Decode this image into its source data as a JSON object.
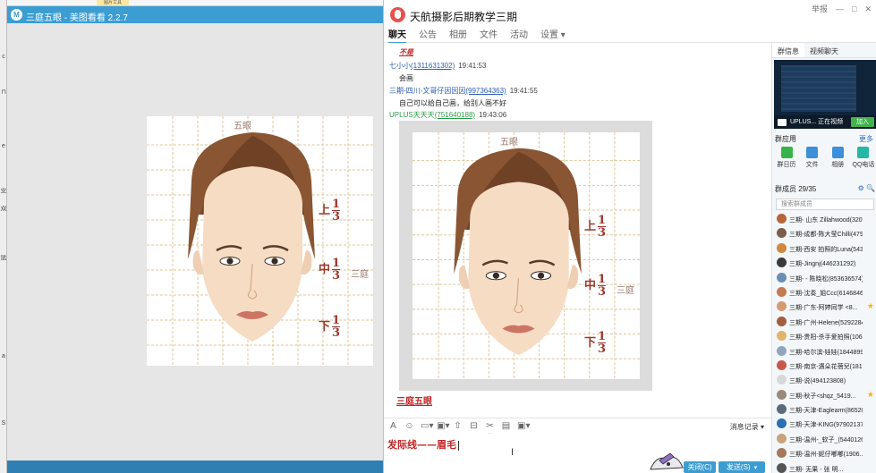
{
  "viewer": {
    "window_title": "三庭五眼 - 美图看看 2.2.7",
    "top_tab": "图片工具",
    "image": {
      "title": "五眼",
      "upper_label": "上",
      "middle_label": "中",
      "lower_label": "下",
      "numerator": "1",
      "denominator": "3",
      "side_label": "三庭"
    }
  },
  "chat": {
    "group_name": "天航摄影后期教学三期",
    "window_buttons": {
      "report": "举报",
      "minimize": "—",
      "maximize": "□",
      "close": "✕"
    },
    "tabs": [
      {
        "label": "聊天",
        "active": true
      },
      {
        "label": "公告"
      },
      {
        "label": "相册"
      },
      {
        "label": "文件"
      },
      {
        "label": "活动"
      },
      {
        "label": "设置 ▾"
      }
    ],
    "messages": [
      {
        "red_text": "不是"
      },
      {
        "name": "七小小",
        "qq": "(1311631302)",
        "time": "19:41:53",
        "text": "会画"
      },
      {
        "name": "三期-四川-文哥仔因因因",
        "qq": "(997364363)",
        "time": "19:41:55",
        "text": "自己可以给自己画，给别人画不好"
      },
      {
        "name": "UPLUS天天天",
        "qq": "(751640188)",
        "time": "19:43:06"
      }
    ],
    "image_caption": "三庭五眼",
    "toolbar": {
      "icons": [
        "A",
        "☺",
        "▭▾",
        "▣▾",
        "⇧",
        "⊟",
        "✂▾",
        "▤",
        "▣▾"
      ],
      "history_label": "消息记录 ▾"
    },
    "input_text": "发际线——眉毛",
    "close_button": "关闭(C)",
    "send_button": "发送(S)",
    "send_caret": "▾"
  },
  "side": {
    "tabs": [
      "群信息",
      "视频聊天"
    ],
    "video_text": "UPLUS... 正在视频",
    "join_label": "加入",
    "apps_title": "群应用",
    "apps_more": "更多",
    "apps": [
      {
        "label": "群日历",
        "color": "#38b34a"
      },
      {
        "label": "文件",
        "color": "#3c8fd8"
      },
      {
        "label": "相册",
        "color": "#3c8fd8"
      },
      {
        "label": "QQ电话",
        "color": "#26b6a4"
      }
    ],
    "members_title": "群成员 29/35",
    "members_icons": "⚙ 🔍",
    "search_placeholder": "搜索群成员",
    "members": [
      {
        "name": "三期-  山东 Zillahwood(32081...",
        "color": "#b5653a"
      },
      {
        "name": "三期-成都-陈大莹Chilli(479...",
        "color": "#7b5e4a"
      },
      {
        "name": "三期-西安 拍照的Luna(543...",
        "color": "#d0873f"
      },
      {
        "name": "三期-Jingnj(446231292)",
        "color": "#3a3a3a"
      },
      {
        "name": "三期- - 陈晓松(853636574)",
        "color": "#6a8fb4"
      },
      {
        "name": "三期-沈奏_姐Ccc(61468460)",
        "color": "#c47a52"
      },
      {
        "name": "三期-广东-阿婷同学 <8...",
        "color": "#d59a72",
        "star": true
      },
      {
        "name": "三期-广州-Helene(52922849...",
        "color": "#a35d40"
      },
      {
        "name": "三期-贵阳-杀手爱拍照(1060...",
        "color": "#e0b46a"
      },
      {
        "name": "三期-哈尔滨-娃娃(18448990...",
        "color": "#8fa6bd"
      },
      {
        "name": "三期-南京-遇朵花蓓兒(1816...",
        "color": "#c8584a"
      },
      {
        "name": "三期-说(494123808)",
        "color": "#d8d8d8"
      },
      {
        "name": "三期-秋子<shqz_5419...",
        "color": "#9a8a7c",
        "star": true
      },
      {
        "name": "三期-天津-Eaglearm(86520...",
        "color": "#5a6b7c"
      },
      {
        "name": "三期-天津-KING(979021373)",
        "color": "#2a6fb0"
      },
      {
        "name": "三期-温州-_软子_(54401268...",
        "color": "#c9a37c"
      },
      {
        "name": "三期-温州-妮仔嘟嘟(1906...",
        "color": "#a4785a"
      },
      {
        "name": "三期- 无果 - 张 明...",
        "color": "#555555"
      }
    ]
  }
}
